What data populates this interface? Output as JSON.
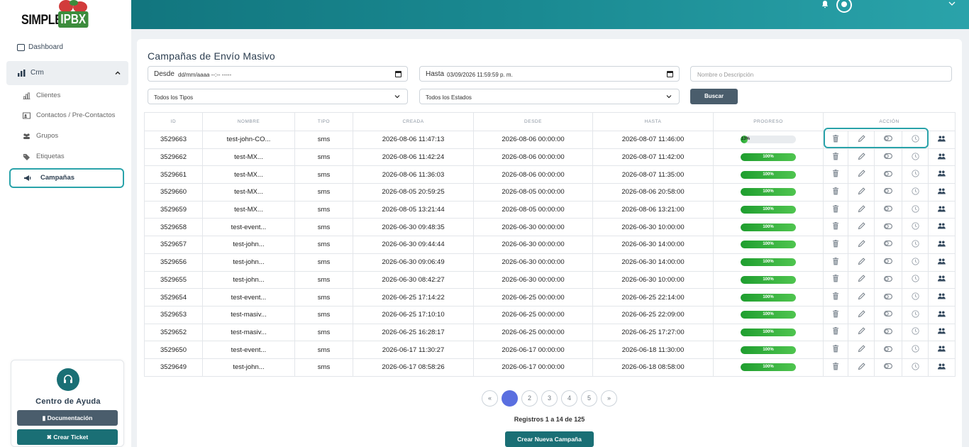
{
  "brand": {
    "simple": "SIMPLE",
    "ipbx": "IPBX"
  },
  "sidebar": {
    "dashboard": "Dashboard",
    "crm": "Crm",
    "items": [
      "Clientes",
      "Contactos / Pre-Contactos",
      "Grupos",
      "Etiquetas",
      "Campañas"
    ]
  },
  "help": {
    "title": "Centro de Ayuda",
    "doc_label": "Documentación",
    "ticket_label": "Crear Ticket"
  },
  "main": {
    "title": "Campañas de Envío Masivo",
    "desde_label": "Desde",
    "desde_value": "dd/mm/aaaa --:-- -----",
    "hasta_label": "Hasta",
    "hasta_value": "03/09/2026 11:59:59 p. m.",
    "search_placeholder": "Nombre o Descripción",
    "tipos_value": "Todos los Tipos",
    "estados_value": "Todos los Estados",
    "buscar_label": "Buscar",
    "registros": "Registros 1 a 14 de 125",
    "nueva_label": "Crear Nueva Campaña"
  },
  "table": {
    "headers": [
      "ID",
      "NOMBRE",
      "TIPO",
      "CREADA",
      "DESDE",
      "HASTA",
      "PROGRESO",
      "ACCIÓN"
    ],
    "rows": [
      {
        "id": "3529663",
        "nombre": "test-john-CO...",
        "tipo": "sms",
        "creada": "2026-08-06 11:47:13",
        "desde": "2026-08-06 00:00:00",
        "hasta": "2026-08-07 11:46:00",
        "progress": 0.13,
        "pct": "13%"
      },
      {
        "id": "3529662",
        "nombre": "test-MX...",
        "tipo": "sms",
        "creada": "2026-08-06 11:42:24",
        "desde": "2026-08-06 00:00:00",
        "hasta": "2026-08-07 11:42:00",
        "progress": 1,
        "pct": "100%"
      },
      {
        "id": "3529661",
        "nombre": "test-MX...",
        "tipo": "sms",
        "creada": "2026-08-06 11:36:03",
        "desde": "2026-08-06 00:00:00",
        "hasta": "2026-08-07 11:35:00",
        "progress": 1,
        "pct": "100%"
      },
      {
        "id": "3529660",
        "nombre": "test-MX...",
        "tipo": "sms",
        "creada": "2026-08-05 20:59:25",
        "desde": "2026-08-05 00:00:00",
        "hasta": "2026-08-06 20:58:00",
        "progress": 1,
        "pct": "100%"
      },
      {
        "id": "3529659",
        "nombre": "test-MX...",
        "tipo": "sms",
        "creada": "2026-08-05 13:21:44",
        "desde": "2026-08-05 00:00:00",
        "hasta": "2026-08-06 13:21:00",
        "progress": 1,
        "pct": "100%"
      },
      {
        "id": "3529658",
        "nombre": "test-event...",
        "tipo": "sms",
        "creada": "2026-06-30 09:48:35",
        "desde": "2026-06-30 00:00:00",
        "hasta": "2026-06-30 10:00:00",
        "progress": 1,
        "pct": "100%"
      },
      {
        "id": "3529657",
        "nombre": "test-john...",
        "tipo": "sms",
        "creada": "2026-06-30 09:44:44",
        "desde": "2026-06-30 00:00:00",
        "hasta": "2026-06-30 14:00:00",
        "progress": 1,
        "pct": "100%"
      },
      {
        "id": "3529656",
        "nombre": "test-john...",
        "tipo": "sms",
        "creada": "2026-06-30 09:06:49",
        "desde": "2026-06-30 00:00:00",
        "hasta": "2026-06-30 14:00:00",
        "progress": 1,
        "pct": "100%"
      },
      {
        "id": "3529655",
        "nombre": "test-john...",
        "tipo": "sms",
        "creada": "2026-06-30 08:42:27",
        "desde": "2026-06-30 00:00:00",
        "hasta": "2026-06-30 10:00:00",
        "progress": 1,
        "pct": "100%"
      },
      {
        "id": "3529654",
        "nombre": "test-event...",
        "tipo": "sms",
        "creada": "2026-06-25 17:14:22",
        "desde": "2026-06-25 00:00:00",
        "hasta": "2026-06-25 22:14:00",
        "progress": 1,
        "pct": "100%"
      },
      {
        "id": "3529653",
        "nombre": "test-masiv...",
        "tipo": "sms",
        "creada": "2026-06-25 17:10:10",
        "desde": "2026-06-25 00:00:00",
        "hasta": "2026-06-25 22:09:00",
        "progress": 1,
        "pct": "100%"
      },
      {
        "id": "3529652",
        "nombre": "test-masiv...",
        "tipo": "sms",
        "creada": "2026-06-25 16:28:17",
        "desde": "2026-06-25 00:00:00",
        "hasta": "2026-06-25 17:27:00",
        "progress": 1,
        "pct": "100%"
      },
      {
        "id": "3529650",
        "nombre": "test-event...",
        "tipo": "sms",
        "creada": "2026-06-17 11:30:27",
        "desde": "2026-06-17 00:00:00",
        "hasta": "2026-06-18 11:30:00",
        "progress": 1,
        "pct": "100%"
      },
      {
        "id": "3529649",
        "nombre": "test-john...",
        "tipo": "sms",
        "creada": "2026-06-17 08:58:26",
        "desde": "2026-06-17 00:00:00",
        "hasta": "2026-06-18 08:58:00",
        "progress": 1,
        "pct": "100%"
      }
    ],
    "actions": [
      "trash-icon",
      "pencil-icon",
      "toggle-icon",
      "clock-icon",
      "users-icon"
    ]
  },
  "pagination": {
    "prev": "«",
    "pages": [
      "1",
      "2",
      "3",
      "4",
      "5"
    ],
    "next": "»",
    "current": "1"
  },
  "colors": {
    "teal": "#1a6f75",
    "accent": "#2aa3aa",
    "progress_green": "#3cb84a",
    "pager_active": "#5a6fe0"
  }
}
